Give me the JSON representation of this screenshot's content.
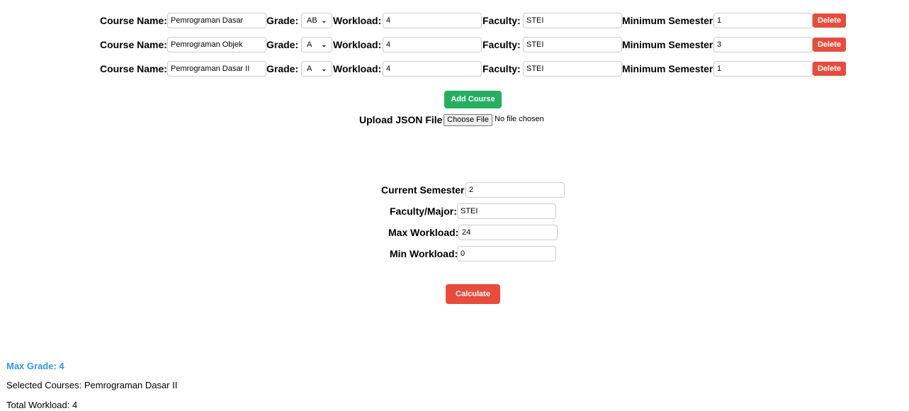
{
  "labels": {
    "course_name": "Course Name:",
    "grade": "Grade:",
    "workload": "Workload:",
    "faculty": "Faculty:",
    "min_semester": "Minimum Semester:",
    "delete": "Delete"
  },
  "courses": [
    {
      "name": "Pemrograman Dasar",
      "grade": "AB",
      "workload": "4",
      "faculty": "STEI",
      "min_semester": "1"
    },
    {
      "name": "Pemrograman Objek",
      "grade": "A",
      "workload": "4",
      "faculty": "STEI",
      "min_semester": "3"
    },
    {
      "name": "Pemrograman Dasar II",
      "grade": "A",
      "workload": "4",
      "faculty": "STEI",
      "min_semester": "1"
    }
  ],
  "add_course": "Add Course",
  "upload": {
    "label": "Upload JSON File:",
    "button": "Choose File",
    "status": "No file chosen"
  },
  "settings": {
    "current_semester_label": "Current Semester:",
    "current_semester": "2",
    "faculty_label": "Faculty/Major:",
    "faculty": "STEI",
    "max_workload_label": "Max Workload:",
    "max_workload": "24",
    "min_workload_label": "Min Workload:",
    "min_workload": "0"
  },
  "calculate": "Calculate",
  "results": {
    "max_grade": "Max Grade: 4",
    "selected": "Selected Courses: Pemrograman Dasar II",
    "total": "Total Workload: 4"
  },
  "colors": {
    "green": "#27ae60",
    "red": "#e74c3c",
    "blue": "#3498db"
  }
}
